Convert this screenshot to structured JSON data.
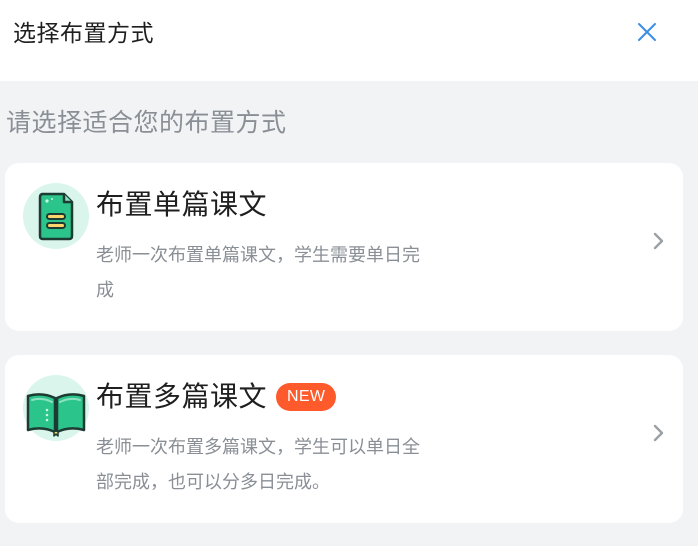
{
  "header": {
    "title": "选择布置方式",
    "close_icon": "close-icon"
  },
  "prompt": "请选择适合您的布置方式",
  "options": [
    {
      "title": "布置单篇课文",
      "description": "老师一次布置单篇课文，学生需要单日完成",
      "icon": "document-icon",
      "badge": ""
    },
    {
      "title": "布置多篇课文",
      "description": "老师一次布置多篇课文，学生可以单日全部完成，也可以分多日完成。",
      "icon": "open-book-icon",
      "badge": "NEW"
    }
  ],
  "colors": {
    "accent_close": "#3a8ee6",
    "icon_bg": "#d9f5ec",
    "icon_green": "#2bc48a",
    "badge_bg": "#ff5a2c",
    "text_primary": "#1f1f1f",
    "text_secondary": "#8a8f96",
    "page_bg": "#f1f3f5"
  }
}
